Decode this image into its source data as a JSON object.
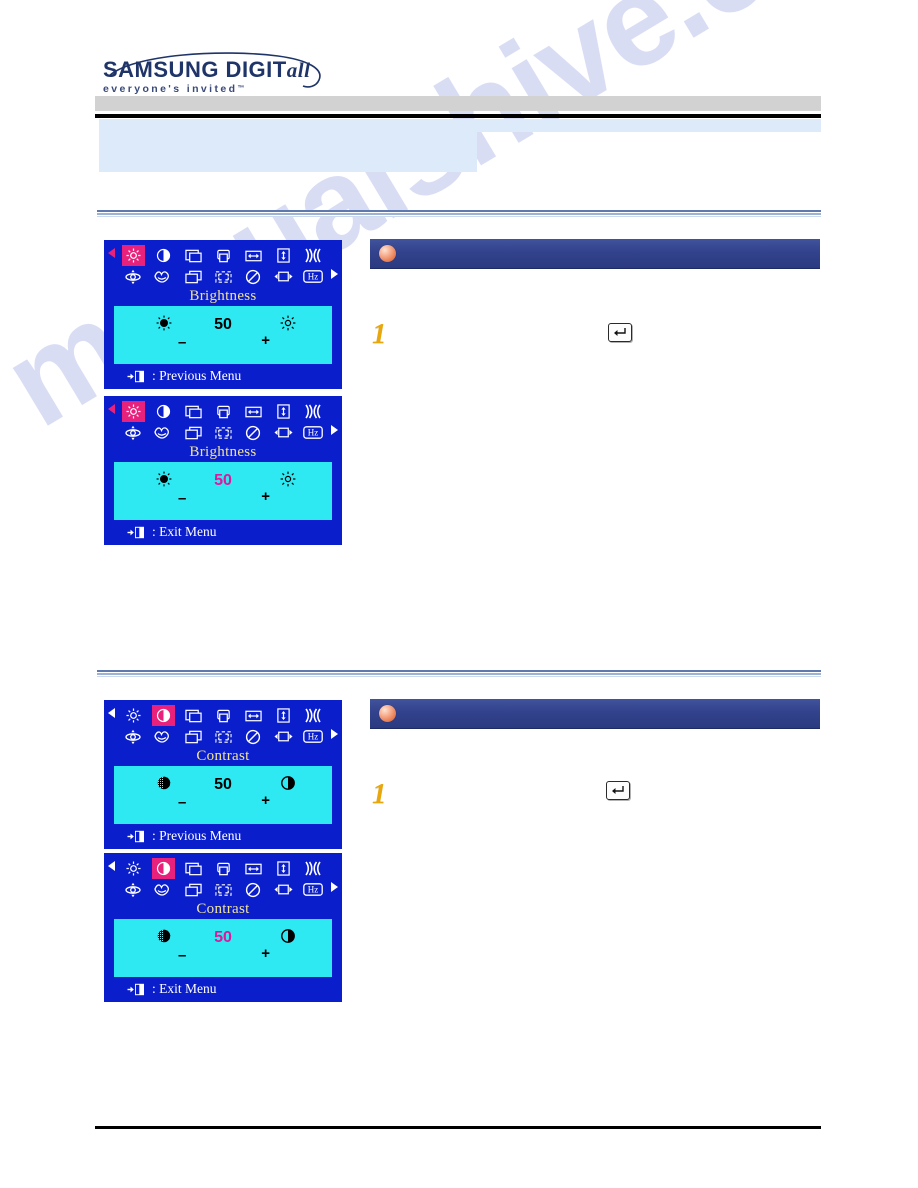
{
  "watermark": {
    "text": "manualshive.com"
  },
  "header": {
    "logo": {
      "brand": "SAMSUNG DIGIT",
      "brand_italic": "all",
      "tagline": "everyone's",
      "tagline_boxed": "invited",
      "trademark": "™"
    }
  },
  "sections": [
    {
      "id": "brightness",
      "titlebar_text": "",
      "step_number": "1",
      "step_text": "",
      "enter_key_icon": "enter-key-icon",
      "osds": [
        {
          "selected_icon": "brightness-icon",
          "title": "Brightness",
          "value": "50",
          "value_color": "#000000",
          "minus": "–",
          "plus": "+",
          "footer": ": Previous Menu",
          "left_icon": "brightness-low-icon",
          "right_icon": "brightness-high-icon"
        },
        {
          "selected_icon": "brightness-icon",
          "title": "Brightness",
          "value": "50",
          "value_color": "#e0169b",
          "minus": "–",
          "plus": "+",
          "footer": ": Exit Menu",
          "left_icon": "brightness-low-icon",
          "right_icon": "brightness-high-icon"
        }
      ]
    },
    {
      "id": "contrast",
      "titlebar_text": "",
      "step_number": "1",
      "step_text": "",
      "enter_key_icon": "enter-key-icon",
      "osds": [
        {
          "selected_icon": "contrast-icon",
          "title": "Contrast",
          "value": "50",
          "value_color": "#000000",
          "minus": "–",
          "plus": "+",
          "footer": ": Previous Menu",
          "left_icon": "contrast-low-icon",
          "right_icon": "contrast-high-icon"
        },
        {
          "selected_icon": "contrast-icon",
          "title": "Contrast",
          "value": "50",
          "value_color": "#e0169b",
          "minus": "–",
          "plus": "+",
          "footer": ": Exit Menu",
          "left_icon": "contrast-low-icon",
          "right_icon": "contrast-high-icon"
        }
      ]
    }
  ],
  "osd_menu_icons": [
    {
      "name": "brightness-icon",
      "row": 1,
      "col": 1
    },
    {
      "name": "contrast-icon",
      "row": 1,
      "col": 2
    },
    {
      "name": "h-position-icon",
      "row": 1,
      "col": 3
    },
    {
      "name": "v-position-icon",
      "row": 1,
      "col": 4
    },
    {
      "name": "h-size-icon",
      "row": 1,
      "col": 5
    },
    {
      "name": "v-size-icon",
      "row": 1,
      "col": 6
    },
    {
      "name": "pincushion-icon",
      "row": 1,
      "col": 7
    },
    {
      "name": "rotation-icon",
      "row": 2,
      "col": 1
    },
    {
      "name": "color-tone-icon",
      "row": 2,
      "col": 2
    },
    {
      "name": "parallelogram-icon",
      "row": 2,
      "col": 3
    },
    {
      "name": "corner-correct-icon",
      "row": 2,
      "col": 4
    },
    {
      "name": "degauss-icon",
      "row": 2,
      "col": 5
    },
    {
      "name": "zoom-icon",
      "row": 2,
      "col": 6
    },
    {
      "name": "frequency-hz-icon",
      "row": 2,
      "col": 7
    }
  ],
  "colors": {
    "osd_bg": "#0a1ecb",
    "osd_panel": "#2ee8f2",
    "osd_select": "#e7217c",
    "osd_title": "#f2e49a",
    "titlebar": "#32428c",
    "step_number": "#e8a80d",
    "value_highlight": "#e0169b",
    "divider": "#5d79ad",
    "header_panel": "#dceafa",
    "gray_band": "#d2d2d2"
  }
}
